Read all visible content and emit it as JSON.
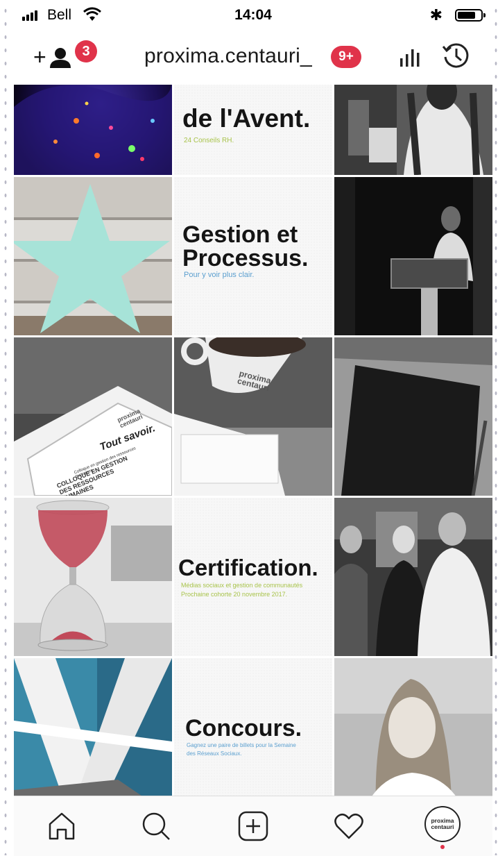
{
  "status_bar": {
    "carrier": "Bell",
    "time": "14:04"
  },
  "header": {
    "username": "proxima.centauri_",
    "follow_requests_badge": "3",
    "notifications_badge": "9+",
    "icons": [
      "add-user-icon",
      "insights-icon",
      "archive-history-icon"
    ]
  },
  "grid": {
    "tile_advent": {
      "title": "de l'Avent.",
      "subtitle": "24 Conseils RH."
    },
    "tile_gestion": {
      "title": "Gestion et\nProcessus.",
      "subtitle": "Pour y voir plus clair."
    },
    "tablet_logo": "proxima\ncentauri",
    "tablet_heading": "Tout savoir.",
    "tablet_lines": [
      "Colloque en gestion des ressources humaines",
      "COLLOQUE EN GESTION DES RESSOURCES HUMAINES"
    ],
    "mug_logo": "proxima\ncentauri",
    "tile_certification": {
      "title": "Certification.",
      "subtitle": "Médias sociaux et gestion de communautés\nProchaine cohorte 20 novembre 2017."
    },
    "tile_concours": {
      "title": "Concours.",
      "subtitle": "Gagnez une paire de billets pour la Semaine\ndes Réseaux Sociaux."
    }
  },
  "tabbar": {
    "tabs": [
      "home-icon",
      "search-icon",
      "new-post-icon",
      "activity-heart-icon",
      "profile-avatar"
    ],
    "profile_label": "proxima\ncentauri"
  },
  "colors": {
    "badge": "#e0334a",
    "accent_green": "#a8c34a",
    "accent_blue": "#5b9fcf"
  }
}
